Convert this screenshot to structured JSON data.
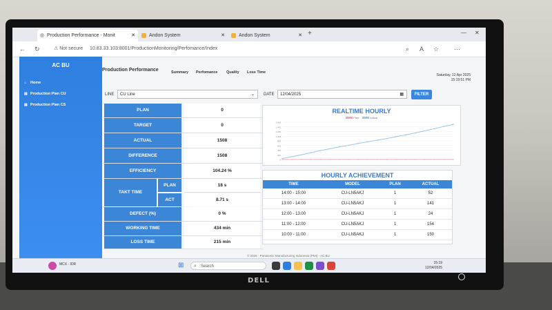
{
  "browser": {
    "tabs": [
      {
        "label": "Production Performance - Monit",
        "active": true
      },
      {
        "label": "Andon System",
        "active": false
      },
      {
        "label": "Andon System",
        "active": false
      }
    ],
    "security": "Not secure",
    "url": "10.83.33.103:8001/ProductionMonitoring/Perfomance/Index"
  },
  "sidebar": {
    "brand": "AC BU",
    "items": [
      {
        "label": "Home",
        "icon": "home-icon"
      },
      {
        "label": "Production Plan CU",
        "icon": "file-icon"
      },
      {
        "label": "Production Plan CS",
        "icon": "file-icon"
      }
    ]
  },
  "header": {
    "title": "Production Performance",
    "nav": [
      "Summary",
      "Perfomance",
      "Quality",
      "Loss Time"
    ],
    "date_line": "Saturday, 12 Apr 2025",
    "time_line": "15:19:51 PM"
  },
  "filters": {
    "line_label": "LINE",
    "line_value": "CU Line",
    "date_label": "DATE",
    "date_value": "12/04/2025",
    "filter_button": "FILTER"
  },
  "kpis": {
    "plan_label": "PLAN",
    "plan": "0",
    "target_label": "TARGET",
    "target": "0",
    "actual_label": "ACTUAL",
    "actual": "1508",
    "difference_label": "DIFFERENCE",
    "difference": "1508",
    "efficiency_label": "EFFICIENCY",
    "efficiency": "104.24 %",
    "takt_label": "TAKT TIME",
    "takt_plan_label": "PLAN",
    "takt_plan": "18 s",
    "takt_act_label": "ACT",
    "takt_act": "8.71 s",
    "defect_label": "DEFECT (%)",
    "defect": "0 %",
    "working_label": "WORKING TIME",
    "working": "434 min",
    "loss_label": "LOSS TIME",
    "loss": "215 min"
  },
  "chart_data": {
    "type": "line",
    "title": "REALTIME HOURLY",
    "legend": [
      "Plan",
      "Actual"
    ],
    "series": [
      {
        "name": "Plan",
        "color": "#f4a6b8",
        "values": [
          0,
          0,
          0,
          0,
          0,
          0,
          0,
          0,
          0,
          0,
          0,
          0,
          0,
          0,
          0,
          0,
          0,
          0,
          0
        ]
      },
      {
        "name": "Actual",
        "color": "#9cc7e6",
        "values": [
          40,
          120,
          200,
          290,
          380,
          460,
          540,
          610,
          690,
          760,
          830,
          900,
          980,
          1060,
          1140,
          1230,
          1320,
          1420,
          1508
        ]
      }
    ],
    "yticks": [
      "1,600",
      "1,400",
      "1,200",
      "1,000",
      "800",
      "600",
      "400",
      "200",
      "0"
    ],
    "ylim": [
      0,
      1600
    ],
    "grid": true,
    "legend_position": "top"
  },
  "hourly": {
    "title": "HOURLY ACHIEVEMENT",
    "columns": [
      "TIME",
      "MODEL",
      "PLAN",
      "ACTUAL"
    ],
    "rows": [
      [
        "14:00 - 15:00",
        "CU-LN5AKJ",
        "1",
        "52"
      ],
      [
        "13:00 - 14:00",
        "CU-LN5AKJ",
        "1",
        "141"
      ],
      [
        "12:00 - 13:00",
        "CU-LN5AKJ",
        "1",
        "24"
      ],
      [
        "11:00 - 12:00",
        "CU-LN5AKJ",
        "1",
        "154"
      ],
      [
        "10:00 - 11:00",
        "CU-LN5AKJ",
        "1",
        "150"
      ]
    ]
  },
  "footer": "© 2025 - Panasonic Manufacturing Indonesia (PMI) - AC BU",
  "taskbar": {
    "search": "Search",
    "notif_title": "MCX - IDR",
    "clock_time": "15:19",
    "clock_date": "12/04/2025"
  },
  "monitor_brand": "DELL"
}
